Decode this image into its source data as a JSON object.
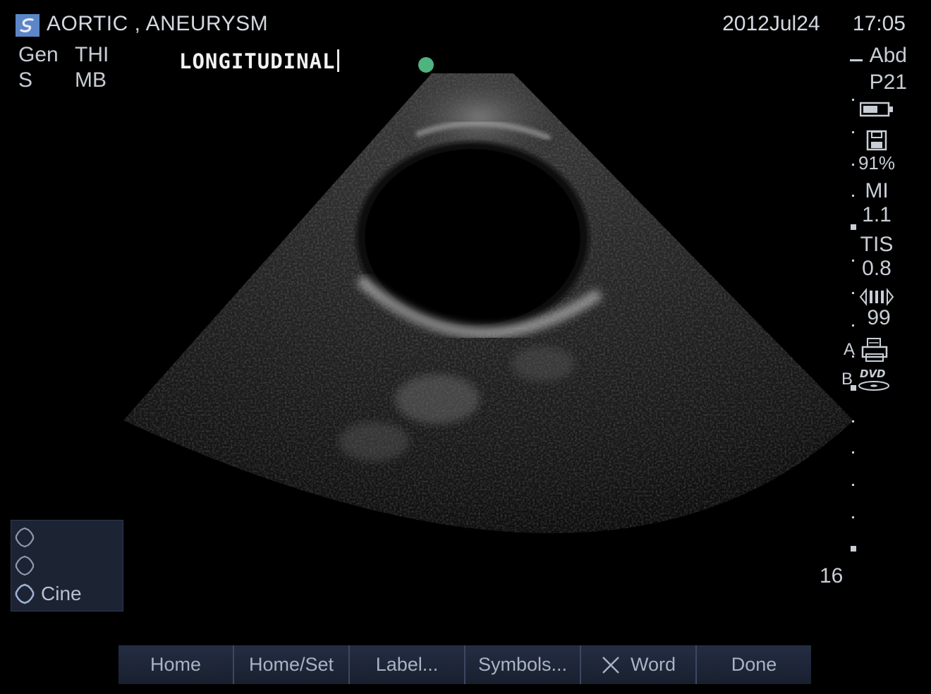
{
  "header": {
    "exam_title": "AORTIC , ANEURYSM",
    "date": "2012Jul24",
    "time": "17:05",
    "logo_icon": "sonosite-logo-icon"
  },
  "mode": {
    "row1_col1": "Gen",
    "row1_col2": "THI",
    "row2_col1": "S",
    "row2_col2": "MB"
  },
  "annotation": {
    "text": "LONGITUDINAL",
    "marker_color": "#4fb37f"
  },
  "right_panel": {
    "exam_type": "Abd",
    "transducer": "P21",
    "battery_icon": "battery-icon",
    "storage_icon": "floppy-disk-icon",
    "storage_percent": "91%",
    "mi_label": "MI",
    "mi_value": "1.1",
    "tis_label": "TIS",
    "tis_value": "0.8",
    "dynamic_range_icon": "dynamic-range-icon",
    "dynamic_range_value": "99",
    "print_label": "A",
    "print_icon": "printer-icon",
    "dvd_label": "B",
    "dvd_icon": "dvd-icon",
    "depth": "16"
  },
  "cine_panel": {
    "items": [
      "",
      "",
      "Cine"
    ],
    "icon": "control-knob-icon"
  },
  "softkeys": [
    {
      "label": "Home"
    },
    {
      "label": "Home/Set"
    },
    {
      "label": "Label..."
    },
    {
      "label": "Symbols..."
    },
    {
      "label": "Word",
      "icon": "close-x-icon"
    },
    {
      "label": "Done"
    }
  ]
}
